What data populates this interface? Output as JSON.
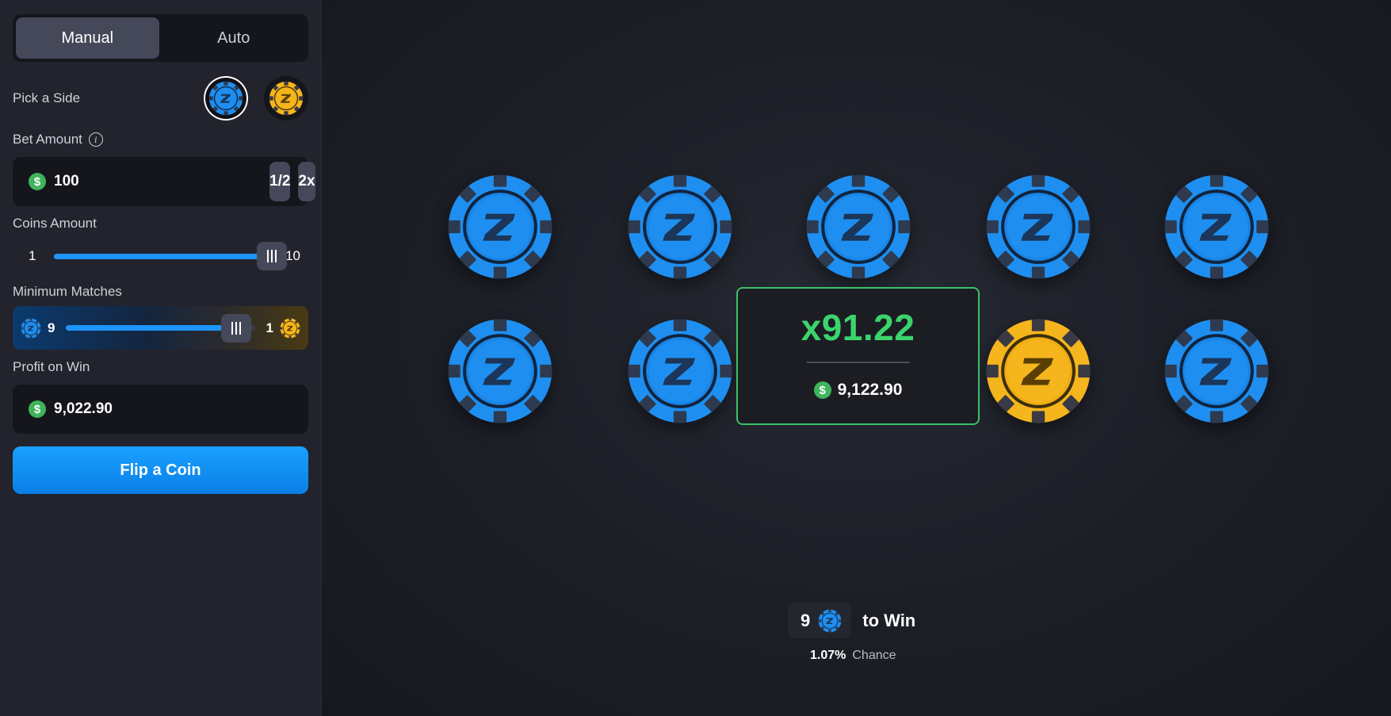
{
  "mode_tabs": {
    "manual": "Manual",
    "auto": "Auto",
    "active": "manual"
  },
  "pick_side": {
    "label": "Pick a Side",
    "selected": "blue"
  },
  "bet": {
    "label": "Bet Amount",
    "value": "100",
    "half_label": "1/2",
    "double_label": "2x"
  },
  "coins_amount": {
    "label": "Coins Amount",
    "min": "1",
    "max": "10",
    "value": 10
  },
  "minimum_matches": {
    "label": "Minimum Matches",
    "blue_count": "9",
    "gold_count": "1",
    "value": 9,
    "max": 10
  },
  "profit": {
    "label": "Profit on Win",
    "value": "9,022.90"
  },
  "flip_button": {
    "label": "Flip a Coin"
  },
  "board": {
    "row1": [
      "blue",
      "blue",
      "blue",
      "blue",
      "blue"
    ],
    "row2": [
      "blue",
      "blue",
      "hidden",
      "gold",
      "blue"
    ]
  },
  "result": {
    "multiplier": "x91.22",
    "payout": "9,122.90"
  },
  "to_win": {
    "count": "9",
    "text": "to Win"
  },
  "chance": {
    "percent": "1.07%",
    "label": "Chance"
  },
  "colors": {
    "accent": "#1e95ff",
    "blue_coin": "#1e8ff0",
    "gold_coin": "#f5b51c",
    "win_green": "#3bd46c",
    "dollar_green": "#3fb45c"
  },
  "icons": [
    "info-icon",
    "dollar-icon",
    "blue-coin-icon",
    "gold-coin-icon",
    "slider-grip-icon"
  ]
}
